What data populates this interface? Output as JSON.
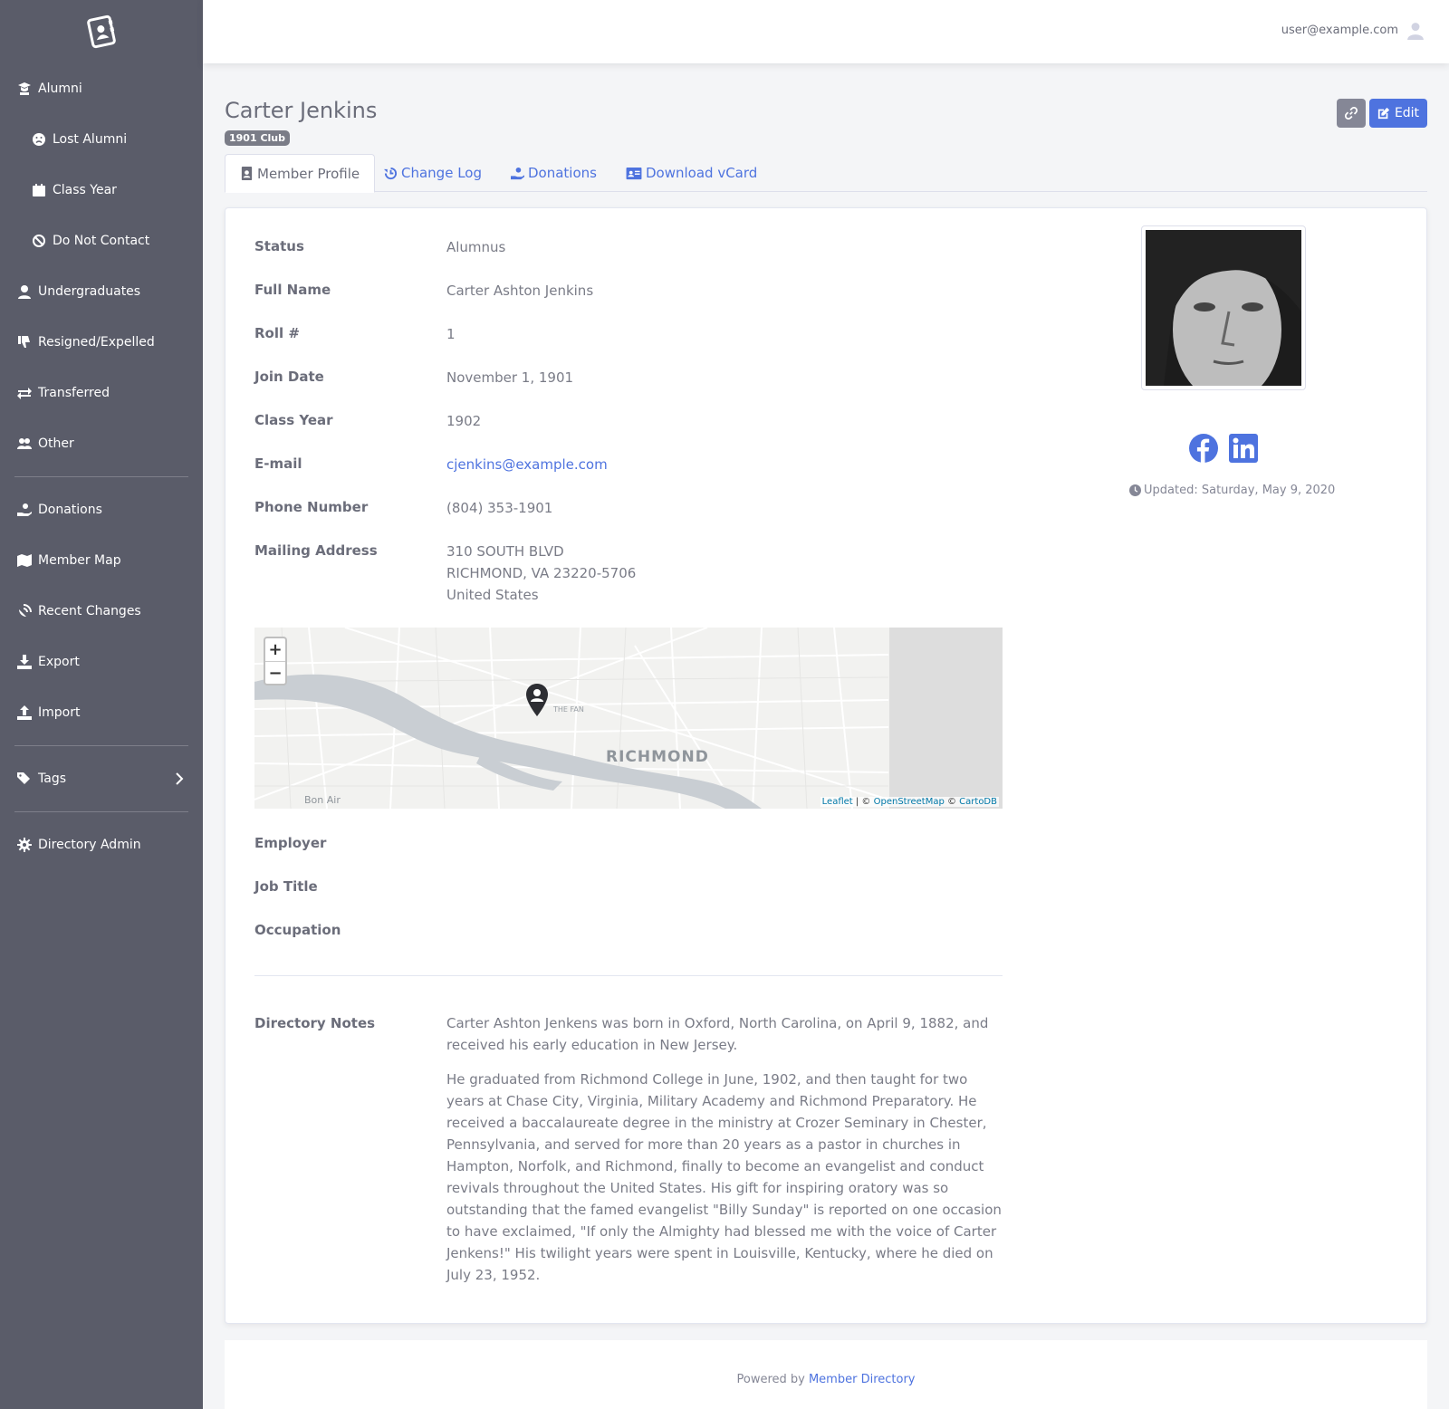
{
  "sidebar": {
    "items": [
      {
        "label": "Alumni"
      },
      {
        "label": "Lost Alumni"
      },
      {
        "label": "Class Year"
      },
      {
        "label": "Do Not Contact"
      },
      {
        "label": "Undergraduates"
      },
      {
        "label": "Resigned/Expelled"
      },
      {
        "label": "Transferred"
      },
      {
        "label": "Other"
      },
      {
        "label": "Donations"
      },
      {
        "label": "Member Map"
      },
      {
        "label": "Recent Changes"
      },
      {
        "label": "Export"
      },
      {
        "label": "Import"
      },
      {
        "label": "Tags"
      },
      {
        "label": "Directory Admin"
      }
    ]
  },
  "topbar": {
    "user_email": "user@example.com"
  },
  "header": {
    "name": "Carter Jenkins",
    "badge": "1901 Club",
    "edit_label": "Edit"
  },
  "tabs": [
    {
      "label": "Member Profile"
    },
    {
      "label": "Change Log"
    },
    {
      "label": "Donations"
    },
    {
      "label": "Download vCard"
    }
  ],
  "profile": {
    "fields": [
      {
        "label": "Status",
        "value": "Alumnus"
      },
      {
        "label": "Full Name",
        "value": "Carter Ashton Jenkins"
      },
      {
        "label": "Roll #",
        "value": "1"
      },
      {
        "label": "Join Date",
        "value": "November 1, 1901"
      },
      {
        "label": "Class Year",
        "value": "1902"
      },
      {
        "label": "E-mail",
        "value": "cjenkins@example.com"
      },
      {
        "label": "Phone Number",
        "value": "(804) 353-1901"
      },
      {
        "label": "Mailing Address",
        "value": "310 SOUTH BLVD"
      }
    ],
    "address_line2": "RICHMOND, VA 23220-5706",
    "address_line3": "United States",
    "employment": [
      {
        "label": "Employer"
      },
      {
        "label": "Job Title"
      },
      {
        "label": "Occupation"
      }
    ],
    "notes_label": "Directory Notes",
    "notes": [
      "Carter Ashton Jenkens was born in Oxford, North Carolina, on April 9, 1882, and received his early education in New Jersey.",
      "He graduated from Richmond College in June, 1902, and then taught for two years at Chase City, Virginia, Military Academy and Richmond Preparatory. He received a baccalaureate degree in the ministry at Crozer Seminary in Chester, Pennsylvania, and served for more than 20 years as a pastor in churches in Hampton, Norfolk, and Richmond, finally to become an evangelist and conduct revivals throughout the United States. His gift for inspiring oratory was so outstanding that the famed evangelist \"Billy Sunday\" is reported on one occasion to have exclaimed, \"If only the Almighty had blessed me with the voice of Carter Jenkens!\" His twilight years were spent in Louisville, Kentucky, where he died on July 23, 1952."
    ]
  },
  "map": {
    "city": "RICHMOND",
    "neighborhood": "THE FAN",
    "suburb": "Bon Air",
    "zoom_in": "+",
    "zoom_out": "−",
    "attrib_leaflet": "Leaflet",
    "attrib_sep": " | © ",
    "attrib_osm": "OpenStreetMap",
    "attrib_sep2": " © ",
    "attrib_carto": "CartoDB"
  },
  "side": {
    "updated": "Updated: Saturday, May 9, 2020"
  },
  "footer": {
    "prefix": "Powered by ",
    "link": "Member Directory"
  }
}
